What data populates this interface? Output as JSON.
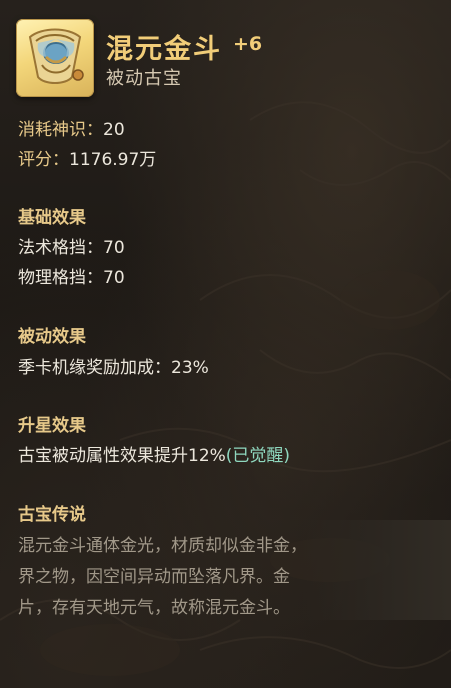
{
  "item": {
    "name": "混元金斗",
    "level": "+6",
    "type": "被动古宝"
  },
  "stats": {
    "cost_label": "消耗神识：",
    "cost_value": "20",
    "score_label": "评分：",
    "score_value": "1176.97万"
  },
  "base_effect": {
    "heading": "基础效果",
    "lines": [
      {
        "label": "法术格挡：",
        "value": "70"
      },
      {
        "label": "物理格挡：",
        "value": "70"
      }
    ]
  },
  "passive_effect": {
    "heading": "被动效果",
    "text": "季卡机缘奖励加成：23%"
  },
  "star_effect": {
    "heading": "升星效果",
    "text": "古宝被动属性效果提升12%",
    "status": "(已觉醒)"
  },
  "lore": {
    "heading": "古宝传说",
    "lines": [
      "混元金斗通体金光，材质却似金非金，",
      "界之物，因空间异动而坠落凡界。金",
      "片，存有天地元气，故称混元金斗。"
    ]
  },
  "icon": {
    "name": "golden-dou-icon",
    "frame_color": "#f3d67a"
  },
  "colors": {
    "title": "#f1cd79",
    "heading": "#e7c98a",
    "body": "#ece7dc",
    "awakened": "#8fd8bf",
    "lore": "#a19889"
  }
}
